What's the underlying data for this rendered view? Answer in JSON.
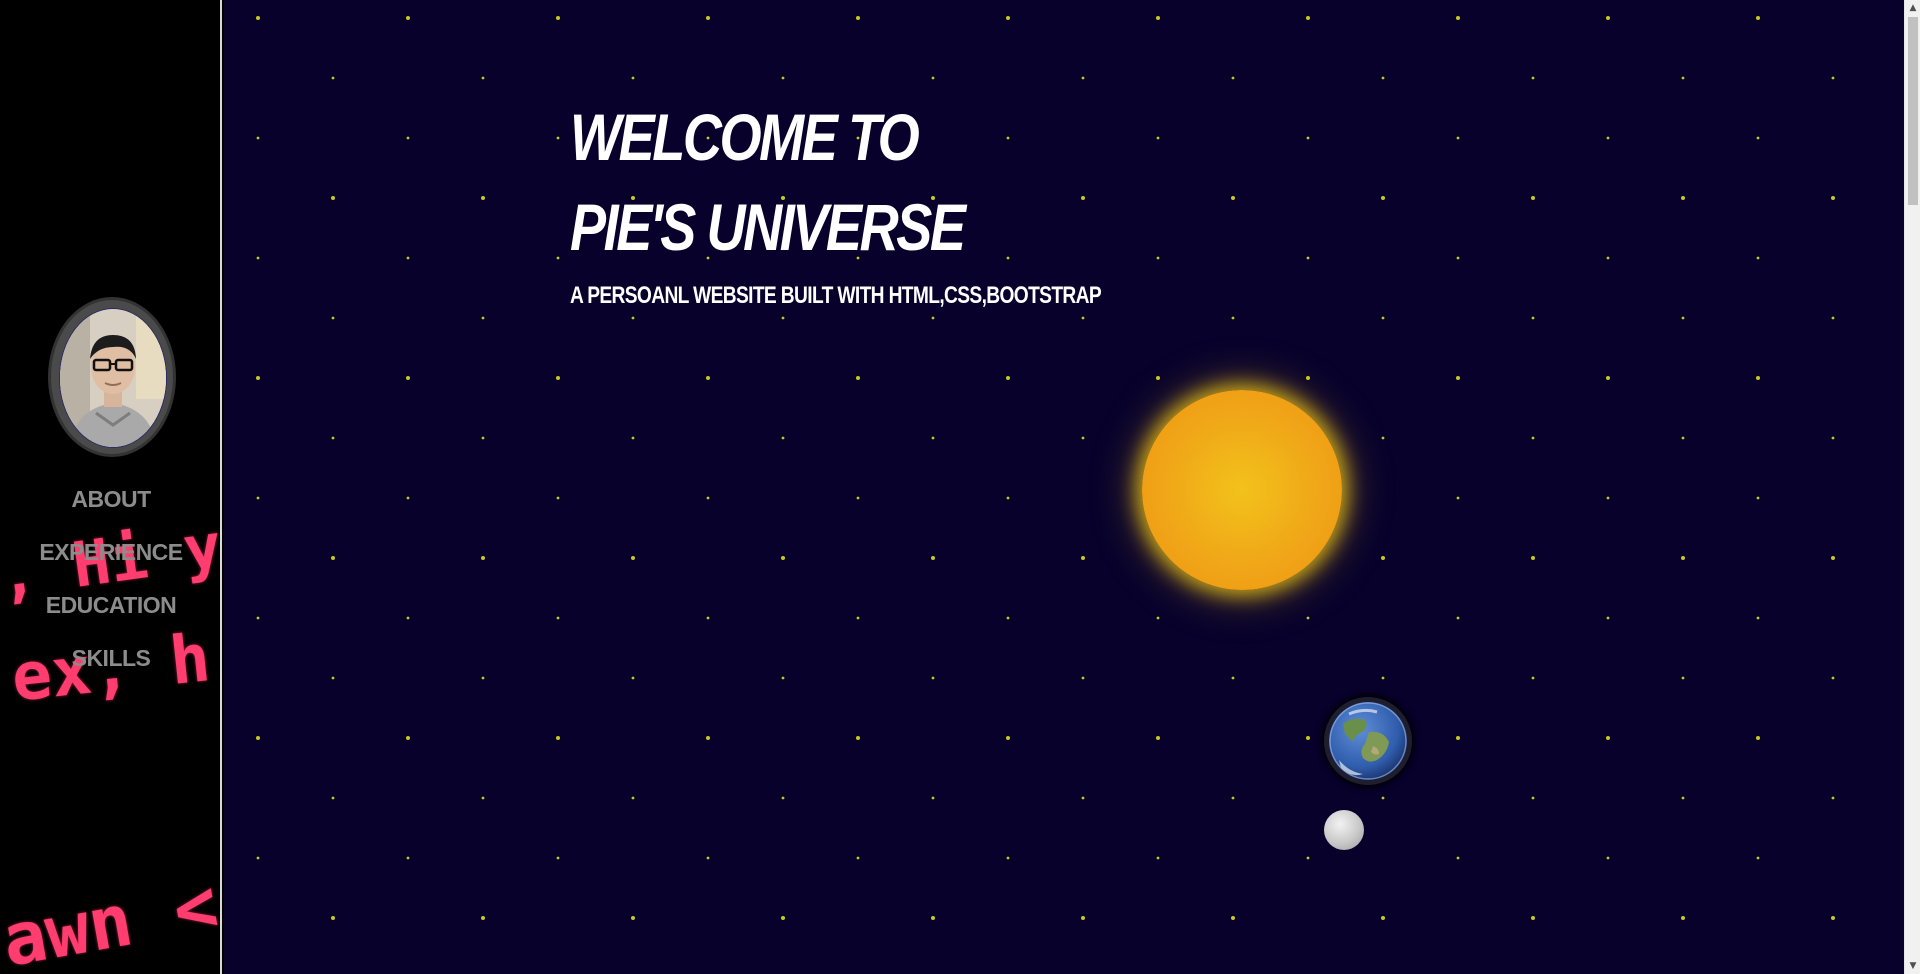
{
  "sidebar": {
    "code_fragments": [
      ", Hi y",
      "ex, h",
      "awn <"
    ],
    "nav": [
      {
        "label": "ABOUT"
      },
      {
        "label": "EXPERIENCE"
      },
      {
        "label": "EDUCATION"
      },
      {
        "label": "SKILLS"
      }
    ]
  },
  "hero": {
    "title_line1": "WELCOME TO",
    "title_line2": "PIE'S UNIVERSE",
    "subtitle": "A PERSOANL WEBSITE BUILT WITH HTML,CSS,BOOTSTRAP"
  },
  "colors": {
    "space_background": "#07012c",
    "star": "#c8c81e",
    "sun": "#f0a618",
    "nav_text": "#8c8c8c",
    "code_text": "#ff3d6e"
  },
  "icons": {
    "scroll_up": "▲",
    "scroll_down": "▼"
  }
}
